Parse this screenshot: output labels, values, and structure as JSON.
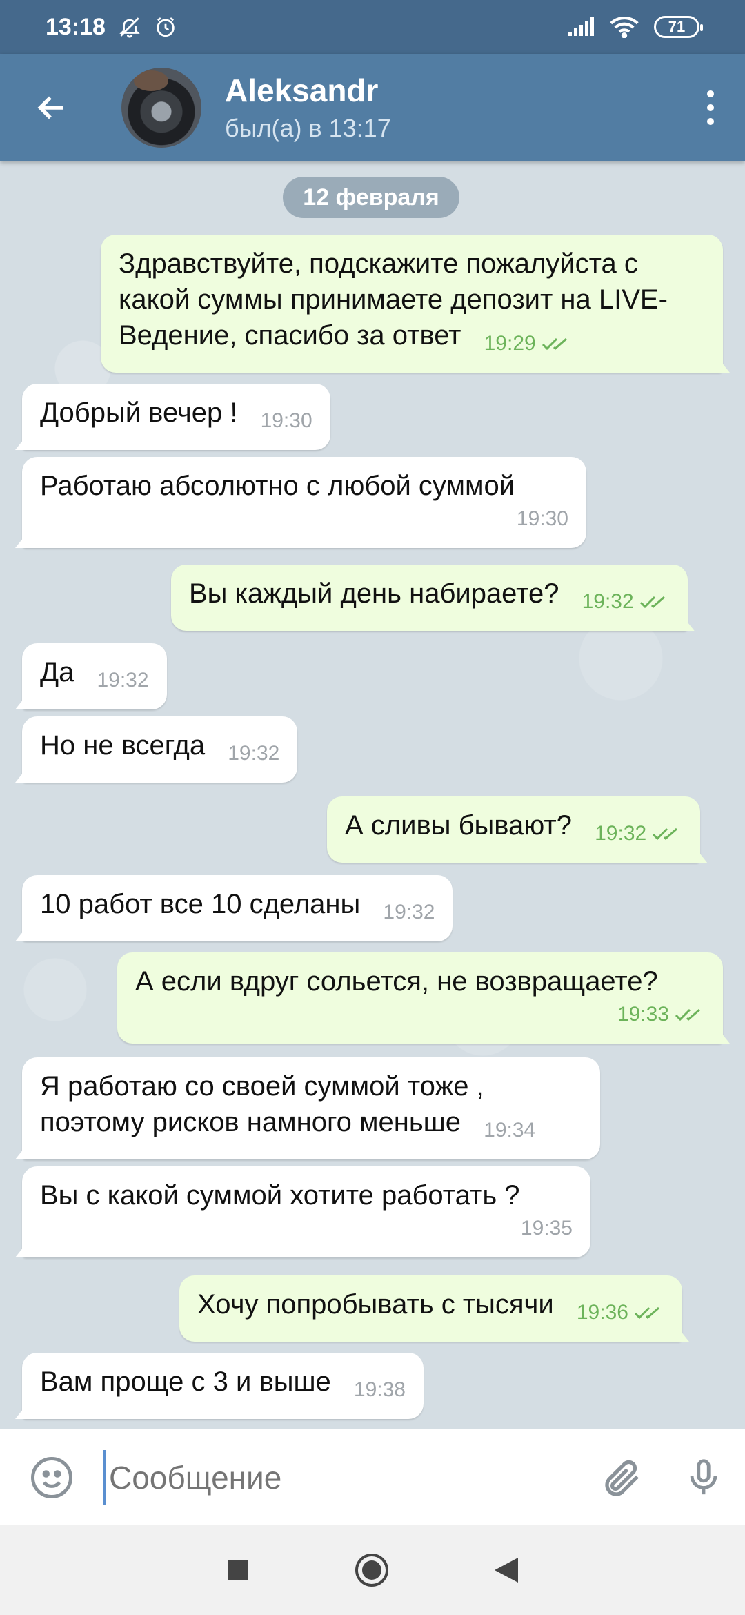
{
  "status_bar": {
    "time": "13:18",
    "icons": [
      "bell-muted-icon",
      "alarm-icon",
      "signal-icon",
      "wifi-icon",
      "battery-icon"
    ],
    "battery": "71"
  },
  "header": {
    "name": "Aleksandr",
    "status": "был(а) в 13:17",
    "back_icon": "arrow-left-icon",
    "menu_icon": "more-vertical-icon"
  },
  "chat": {
    "date": "12 февраля",
    "messages": [
      {
        "dir": "out",
        "text": "Здравствуйте, подскажите пожалуйста с какой суммы принимаете депозит  на LIVE-Ведение, спасибо за ответ",
        "time": "19:29"
      },
      {
        "dir": "in",
        "text": "Добрый вечер !",
        "time": "19:30"
      },
      {
        "dir": "in",
        "text": "Работаю абсолютно с любой суммой",
        "time": "19:30"
      },
      {
        "dir": "out",
        "text": "Вы каждый день набираете?",
        "time": "19:32"
      },
      {
        "dir": "in",
        "text": "Да",
        "time": "19:32"
      },
      {
        "dir": "in",
        "text": "Но не всегда",
        "time": "19:32"
      },
      {
        "dir": "out",
        "text": "А сливы бывают?",
        "time": "19:32"
      },
      {
        "dir": "in",
        "text": "10 работ все 10 сделаны",
        "time": "19:32"
      },
      {
        "dir": "out",
        "text": "А если вдруг сольется, не возвращаете?",
        "time": "19:33"
      },
      {
        "dir": "in",
        "text": "Я работаю со своей суммой тоже , поэтому рисков намного меньше",
        "time": "19:34"
      },
      {
        "dir": "in",
        "text": "Вы с какой суммой хотите работать ?",
        "time": "19:35"
      },
      {
        "dir": "out",
        "text": "Хочу попробывать с тысячи",
        "time": "19:36"
      },
      {
        "dir": "in",
        "text": "Вам проще с 3 и выше",
        "time": "19:38"
      }
    ]
  },
  "input": {
    "placeholder": "Сообщение"
  },
  "colors": {
    "status_bar": "#45698c",
    "header": "#527da3",
    "incoming_bubble": "#ffffff",
    "outgoing_bubble": "#effdde",
    "check_green": "#6cb35a"
  }
}
